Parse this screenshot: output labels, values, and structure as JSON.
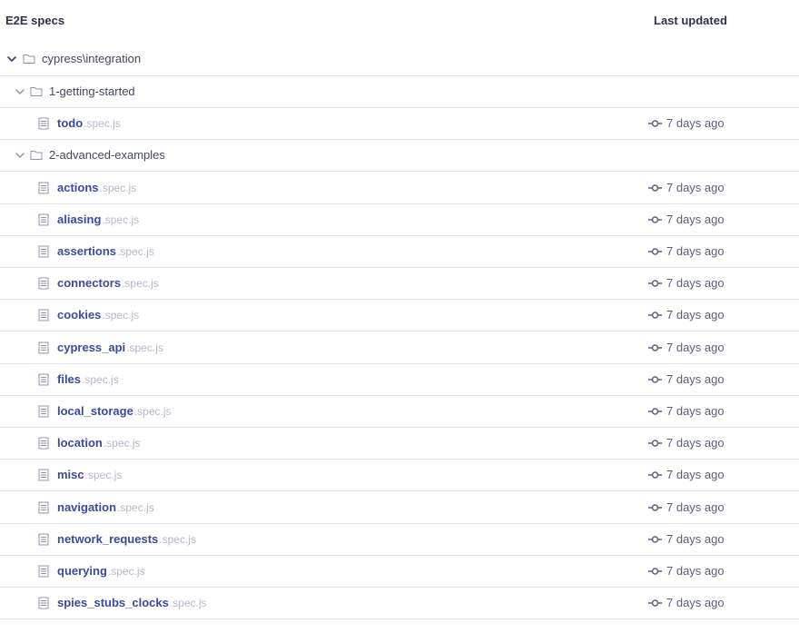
{
  "header": {
    "title": "E2E specs",
    "last_updated": "Last updated"
  },
  "tree": {
    "root": {
      "label": "cypress\\integration"
    },
    "groups": [
      {
        "label": "1-getting-started",
        "specs": [
          {
            "name": "todo",
            "ext": ".spec.js",
            "updated": "7 days ago"
          }
        ]
      },
      {
        "label": "2-advanced-examples",
        "specs": [
          {
            "name": "actions",
            "ext": ".spec.js",
            "updated": "7 days ago"
          },
          {
            "name": "aliasing",
            "ext": ".spec.js",
            "updated": "7 days ago"
          },
          {
            "name": "assertions",
            "ext": ".spec.js",
            "updated": "7 days ago"
          },
          {
            "name": "connectors",
            "ext": ".spec.js",
            "updated": "7 days ago"
          },
          {
            "name": "cookies",
            "ext": ".spec.js",
            "updated": "7 days ago"
          },
          {
            "name": "cypress_api",
            "ext": ".spec.js",
            "updated": "7 days ago"
          },
          {
            "name": "files",
            "ext": ".spec.js",
            "updated": "7 days ago"
          },
          {
            "name": "local_storage",
            "ext": ".spec.js",
            "updated": "7 days ago"
          },
          {
            "name": "location",
            "ext": ".spec.js",
            "updated": "7 days ago"
          },
          {
            "name": "misc",
            "ext": ".spec.js",
            "updated": "7 days ago"
          },
          {
            "name": "navigation",
            "ext": ".spec.js",
            "updated": "7 days ago"
          },
          {
            "name": "network_requests",
            "ext": ".spec.js",
            "updated": "7 days ago"
          },
          {
            "name": "querying",
            "ext": ".spec.js",
            "updated": "7 days ago"
          },
          {
            "name": "spies_stubs_clocks",
            "ext": ".spec.js",
            "updated": "7 days ago"
          }
        ]
      }
    ]
  },
  "colors": {
    "spec_name": "#3a4aa0",
    "spec_ext": "#b4b7c8",
    "row_border": "#e1e3ed",
    "icon": "#9095ad"
  },
  "icons": {
    "chevron": "chevron-down-icon",
    "folder": "folder-icon",
    "file": "document-icon",
    "commit": "git-commit-icon"
  }
}
